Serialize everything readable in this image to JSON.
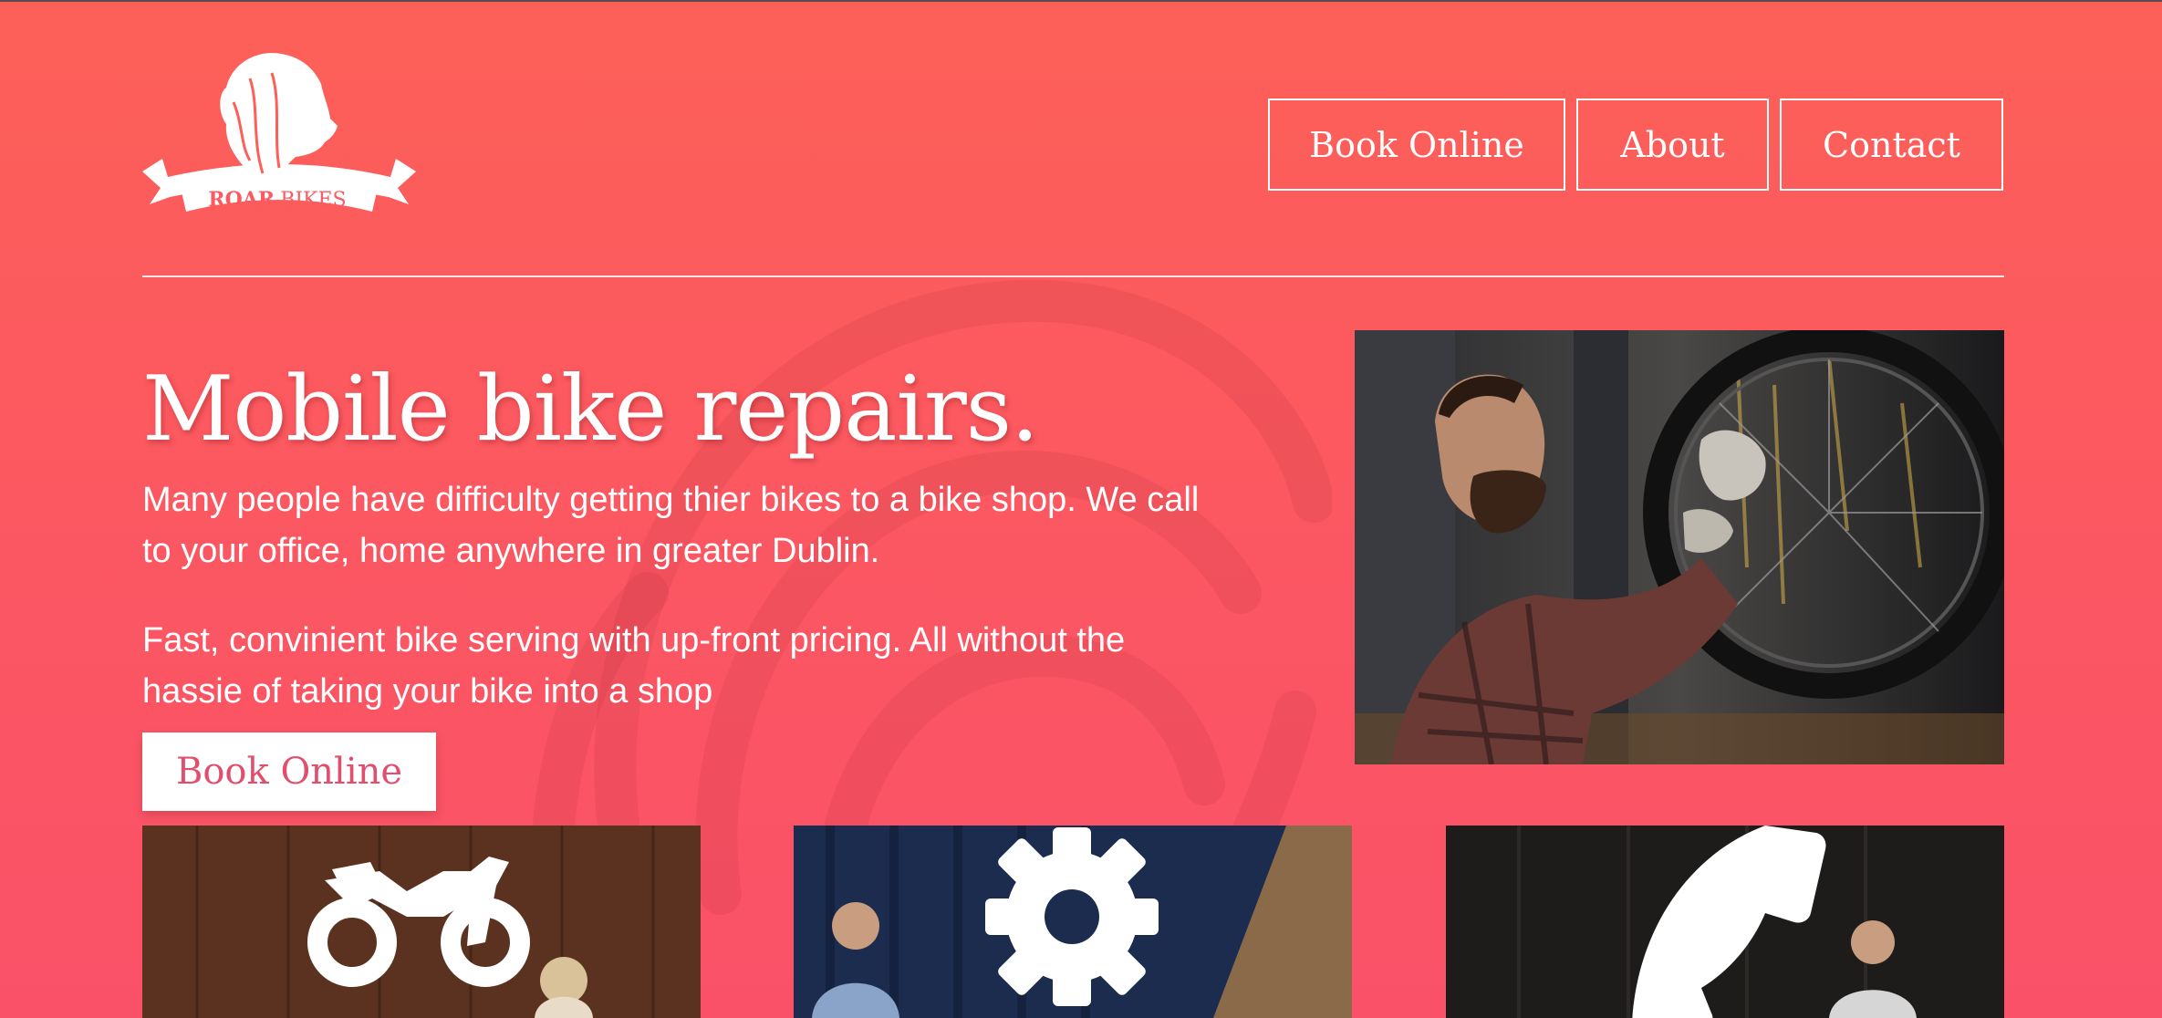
{
  "brand": {
    "logo_text_bold": "ROAR",
    "logo_text_light": "BIKES",
    "logo_icon": "lion-head-icon"
  },
  "nav": {
    "items": [
      {
        "label": "Book Online"
      },
      {
        "label": "About"
      },
      {
        "label": "Contact"
      }
    ]
  },
  "hero": {
    "title": "Mobile bike repairs.",
    "paragraph1": "Many people have difficulty getting thier bikes to a bike shop. We call to your office, home anywhere in greater Dublin.",
    "paragraph2": "Fast, convinient bike serving with up-front pricing. All without the hassie of taking your bike into a shop",
    "cta_label": "Book Online"
  },
  "cards": [
    {
      "icon": "motorbike-icon"
    },
    {
      "icon": "gear-icon"
    },
    {
      "icon": "phone-icon"
    }
  ],
  "colors": {
    "background_top": "#fd6058",
    "background_bottom": "#fa5168",
    "cta_text": "#e14f6f",
    "white": "#ffffff"
  }
}
